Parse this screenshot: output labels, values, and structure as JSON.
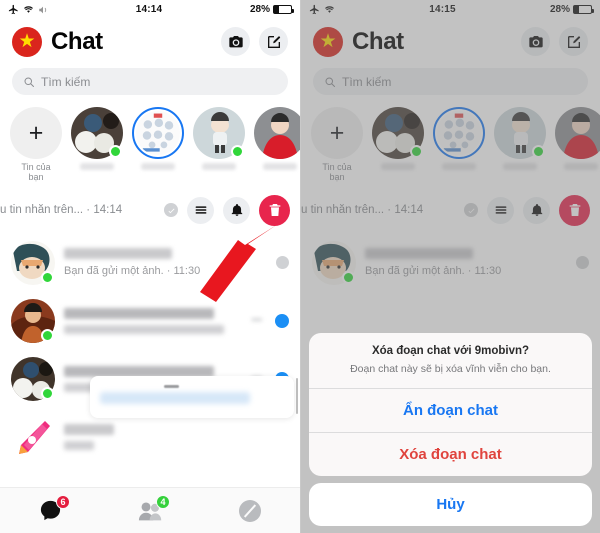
{
  "panels": [
    {
      "id": "left",
      "status": {
        "time": "14:14",
        "battery_percent": "28%",
        "icons": [
          "airplane-icon",
          "wifi-icon",
          "mute-icon"
        ]
      },
      "header": {
        "title": "Chat",
        "camera_icon": "camera-icon",
        "compose_icon": "compose-icon"
      },
      "search": {
        "placeholder": "Tìm kiếm",
        "icon": "search-icon"
      },
      "stories": {
        "add_label_line1": "Tin của",
        "add_label_line2": "bạn"
      },
      "swiped_row": {
        "preview": "u tin nhắn trên... · 14:14",
        "actions": [
          "seen-check-icon",
          "menu-icon",
          "bell-icon",
          "trash-icon"
        ]
      },
      "rows": [
        {
          "subtitle": "Bạn đã gửi một ảnh. · 11:30"
        },
        {
          "subtitle": ""
        },
        {
          "subtitle": ""
        },
        {
          "subtitle": ""
        }
      ],
      "tabs": [
        {
          "name": "chats",
          "icon": "chat-bubble-icon",
          "badge": "6",
          "badge_color": "#e41e3f"
        },
        {
          "name": "people",
          "icon": "people-icon",
          "badge": "4",
          "badge_color": "#35d13c"
        },
        {
          "name": "discover",
          "icon": "circle-slash-icon",
          "badge": ""
        }
      ]
    },
    {
      "id": "right",
      "status": {
        "time": "14:15",
        "battery_percent": "28%",
        "icons": [
          "airplane-icon",
          "wifi-icon"
        ]
      },
      "header": {
        "title": "Chat",
        "camera_icon": "camera-icon",
        "compose_icon": "compose-icon"
      },
      "search": {
        "placeholder": "Tìm kiếm",
        "icon": "search-icon"
      },
      "stories": {
        "add_label_line1": "Tin của",
        "add_label_line2": "bạn"
      },
      "swiped_row": {
        "preview": "u tin nhắn trên... · 14:14",
        "actions": [
          "seen-check-icon",
          "menu-icon",
          "bell-icon",
          "trash-icon"
        ]
      },
      "rows": [
        {
          "subtitle": "Bạn đã gửi một ảnh. · 11:30"
        }
      ],
      "action_sheet": {
        "title": "Xóa đoạn chat với 9mobivn?",
        "message": "Đoạn chat này sẽ bị xóa vĩnh viễn cho bạn.",
        "hide_label": "Ẩn đoạn chat",
        "delete_label": "Xóa đoạn chat",
        "cancel_label": "Hủy"
      }
    }
  ],
  "colors": {
    "accent_blue": "#1877f2",
    "danger_red": "#e0443e",
    "trash_red": "#e8254d",
    "online_green": "#31d63a",
    "arrow_red": "#e8171f",
    "flag_red": "#da251d",
    "flag_star": "#ffdd00"
  }
}
